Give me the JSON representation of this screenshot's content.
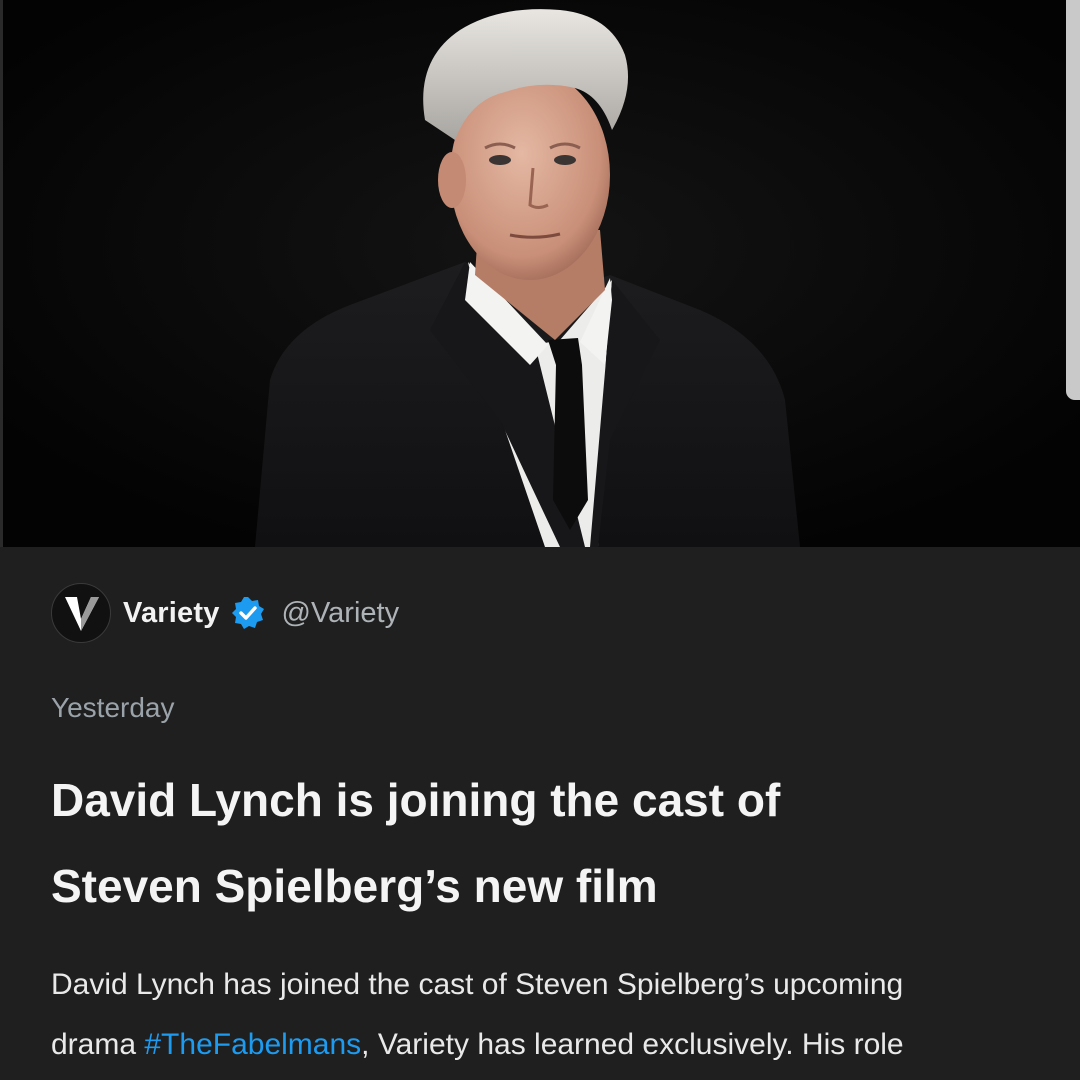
{
  "tweet_card": {
    "author": {
      "name": "Variety",
      "handle": "@Variety",
      "avatar_letter": "V",
      "verified": true
    },
    "timestamp": "Yesterday",
    "headline_line1": "David Lynch is joining the cast of",
    "headline_line2": "Steven Spielberg’s new film",
    "body": {
      "line1": "David Lynch has joined the cast of Steven Spielberg’s upcoming",
      "line2_prefix": "drama ",
      "hashtag": "#TheFabelmans",
      "line2_suffix": ", Variety has learned exclusively. His role"
    }
  },
  "colors": {
    "background": "#1f1f1f",
    "hashtag": "#1d9bf0",
    "verified_badge": "#1d9bf0",
    "secondary_text": "#9ba3aa"
  },
  "icons": {
    "verified": "verified-badge-icon",
    "avatar": "variety-logo-icon"
  }
}
